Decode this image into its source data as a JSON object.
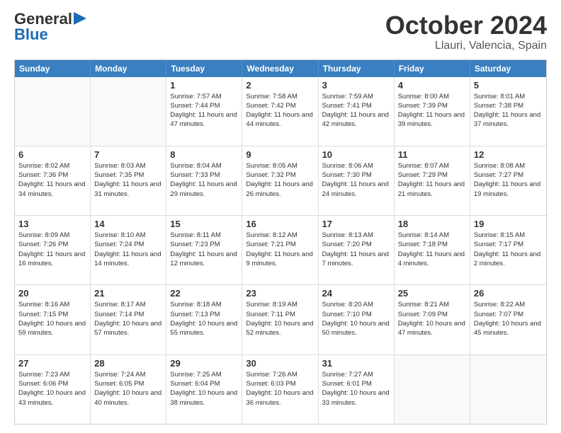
{
  "header": {
    "logo_line1": "General",
    "logo_line2": "Blue",
    "title": "October 2024",
    "subtitle": "Llauri, Valencia, Spain"
  },
  "calendar": {
    "days_of_week": [
      "Sunday",
      "Monday",
      "Tuesday",
      "Wednesday",
      "Thursday",
      "Friday",
      "Saturday"
    ],
    "rows": [
      [
        {
          "day": "",
          "sunrise": "",
          "sunset": "",
          "daylight": "",
          "empty": true
        },
        {
          "day": "",
          "sunrise": "",
          "sunset": "",
          "daylight": "",
          "empty": true
        },
        {
          "day": "1",
          "sunrise": "Sunrise: 7:57 AM",
          "sunset": "Sunset: 7:44 PM",
          "daylight": "Daylight: 11 hours and 47 minutes."
        },
        {
          "day": "2",
          "sunrise": "Sunrise: 7:58 AM",
          "sunset": "Sunset: 7:42 PM",
          "daylight": "Daylight: 11 hours and 44 minutes."
        },
        {
          "day": "3",
          "sunrise": "Sunrise: 7:59 AM",
          "sunset": "Sunset: 7:41 PM",
          "daylight": "Daylight: 11 hours and 42 minutes."
        },
        {
          "day": "4",
          "sunrise": "Sunrise: 8:00 AM",
          "sunset": "Sunset: 7:39 PM",
          "daylight": "Daylight: 11 hours and 39 minutes."
        },
        {
          "day": "5",
          "sunrise": "Sunrise: 8:01 AM",
          "sunset": "Sunset: 7:38 PM",
          "daylight": "Daylight: 11 hours and 37 minutes."
        }
      ],
      [
        {
          "day": "6",
          "sunrise": "Sunrise: 8:02 AM",
          "sunset": "Sunset: 7:36 PM",
          "daylight": "Daylight: 11 hours and 34 minutes."
        },
        {
          "day": "7",
          "sunrise": "Sunrise: 8:03 AM",
          "sunset": "Sunset: 7:35 PM",
          "daylight": "Daylight: 11 hours and 31 minutes."
        },
        {
          "day": "8",
          "sunrise": "Sunrise: 8:04 AM",
          "sunset": "Sunset: 7:33 PM",
          "daylight": "Daylight: 11 hours and 29 minutes."
        },
        {
          "day": "9",
          "sunrise": "Sunrise: 8:05 AM",
          "sunset": "Sunset: 7:32 PM",
          "daylight": "Daylight: 11 hours and 26 minutes."
        },
        {
          "day": "10",
          "sunrise": "Sunrise: 8:06 AM",
          "sunset": "Sunset: 7:30 PM",
          "daylight": "Daylight: 11 hours and 24 minutes."
        },
        {
          "day": "11",
          "sunrise": "Sunrise: 8:07 AM",
          "sunset": "Sunset: 7:29 PM",
          "daylight": "Daylight: 11 hours and 21 minutes."
        },
        {
          "day": "12",
          "sunrise": "Sunrise: 8:08 AM",
          "sunset": "Sunset: 7:27 PM",
          "daylight": "Daylight: 11 hours and 19 minutes."
        }
      ],
      [
        {
          "day": "13",
          "sunrise": "Sunrise: 8:09 AM",
          "sunset": "Sunset: 7:26 PM",
          "daylight": "Daylight: 11 hours and 16 minutes."
        },
        {
          "day": "14",
          "sunrise": "Sunrise: 8:10 AM",
          "sunset": "Sunset: 7:24 PM",
          "daylight": "Daylight: 11 hours and 14 minutes."
        },
        {
          "day": "15",
          "sunrise": "Sunrise: 8:11 AM",
          "sunset": "Sunset: 7:23 PM",
          "daylight": "Daylight: 11 hours and 12 minutes."
        },
        {
          "day": "16",
          "sunrise": "Sunrise: 8:12 AM",
          "sunset": "Sunset: 7:21 PM",
          "daylight": "Daylight: 11 hours and 9 minutes."
        },
        {
          "day": "17",
          "sunrise": "Sunrise: 8:13 AM",
          "sunset": "Sunset: 7:20 PM",
          "daylight": "Daylight: 11 hours and 7 minutes."
        },
        {
          "day": "18",
          "sunrise": "Sunrise: 8:14 AM",
          "sunset": "Sunset: 7:18 PM",
          "daylight": "Daylight: 11 hours and 4 minutes."
        },
        {
          "day": "19",
          "sunrise": "Sunrise: 8:15 AM",
          "sunset": "Sunset: 7:17 PM",
          "daylight": "Daylight: 11 hours and 2 minutes."
        }
      ],
      [
        {
          "day": "20",
          "sunrise": "Sunrise: 8:16 AM",
          "sunset": "Sunset: 7:15 PM",
          "daylight": "Daylight: 10 hours and 59 minutes."
        },
        {
          "day": "21",
          "sunrise": "Sunrise: 8:17 AM",
          "sunset": "Sunset: 7:14 PM",
          "daylight": "Daylight: 10 hours and 57 minutes."
        },
        {
          "day": "22",
          "sunrise": "Sunrise: 8:18 AM",
          "sunset": "Sunset: 7:13 PM",
          "daylight": "Daylight: 10 hours and 55 minutes."
        },
        {
          "day": "23",
          "sunrise": "Sunrise: 8:19 AM",
          "sunset": "Sunset: 7:11 PM",
          "daylight": "Daylight: 10 hours and 52 minutes."
        },
        {
          "day": "24",
          "sunrise": "Sunrise: 8:20 AM",
          "sunset": "Sunset: 7:10 PM",
          "daylight": "Daylight: 10 hours and 50 minutes."
        },
        {
          "day": "25",
          "sunrise": "Sunrise: 8:21 AM",
          "sunset": "Sunset: 7:09 PM",
          "daylight": "Daylight: 10 hours and 47 minutes."
        },
        {
          "day": "26",
          "sunrise": "Sunrise: 8:22 AM",
          "sunset": "Sunset: 7:07 PM",
          "daylight": "Daylight: 10 hours and 45 minutes."
        }
      ],
      [
        {
          "day": "27",
          "sunrise": "Sunrise: 7:23 AM",
          "sunset": "Sunset: 6:06 PM",
          "daylight": "Daylight: 10 hours and 43 minutes."
        },
        {
          "day": "28",
          "sunrise": "Sunrise: 7:24 AM",
          "sunset": "Sunset: 6:05 PM",
          "daylight": "Daylight: 10 hours and 40 minutes."
        },
        {
          "day": "29",
          "sunrise": "Sunrise: 7:25 AM",
          "sunset": "Sunset: 6:04 PM",
          "daylight": "Daylight: 10 hours and 38 minutes."
        },
        {
          "day": "30",
          "sunrise": "Sunrise: 7:26 AM",
          "sunset": "Sunset: 6:03 PM",
          "daylight": "Daylight: 10 hours and 36 minutes."
        },
        {
          "day": "31",
          "sunrise": "Sunrise: 7:27 AM",
          "sunset": "Sunset: 6:01 PM",
          "daylight": "Daylight: 10 hours and 33 minutes."
        },
        {
          "day": "",
          "sunrise": "",
          "sunset": "",
          "daylight": "",
          "empty": true
        },
        {
          "day": "",
          "sunrise": "",
          "sunset": "",
          "daylight": "",
          "empty": true
        }
      ]
    ]
  }
}
